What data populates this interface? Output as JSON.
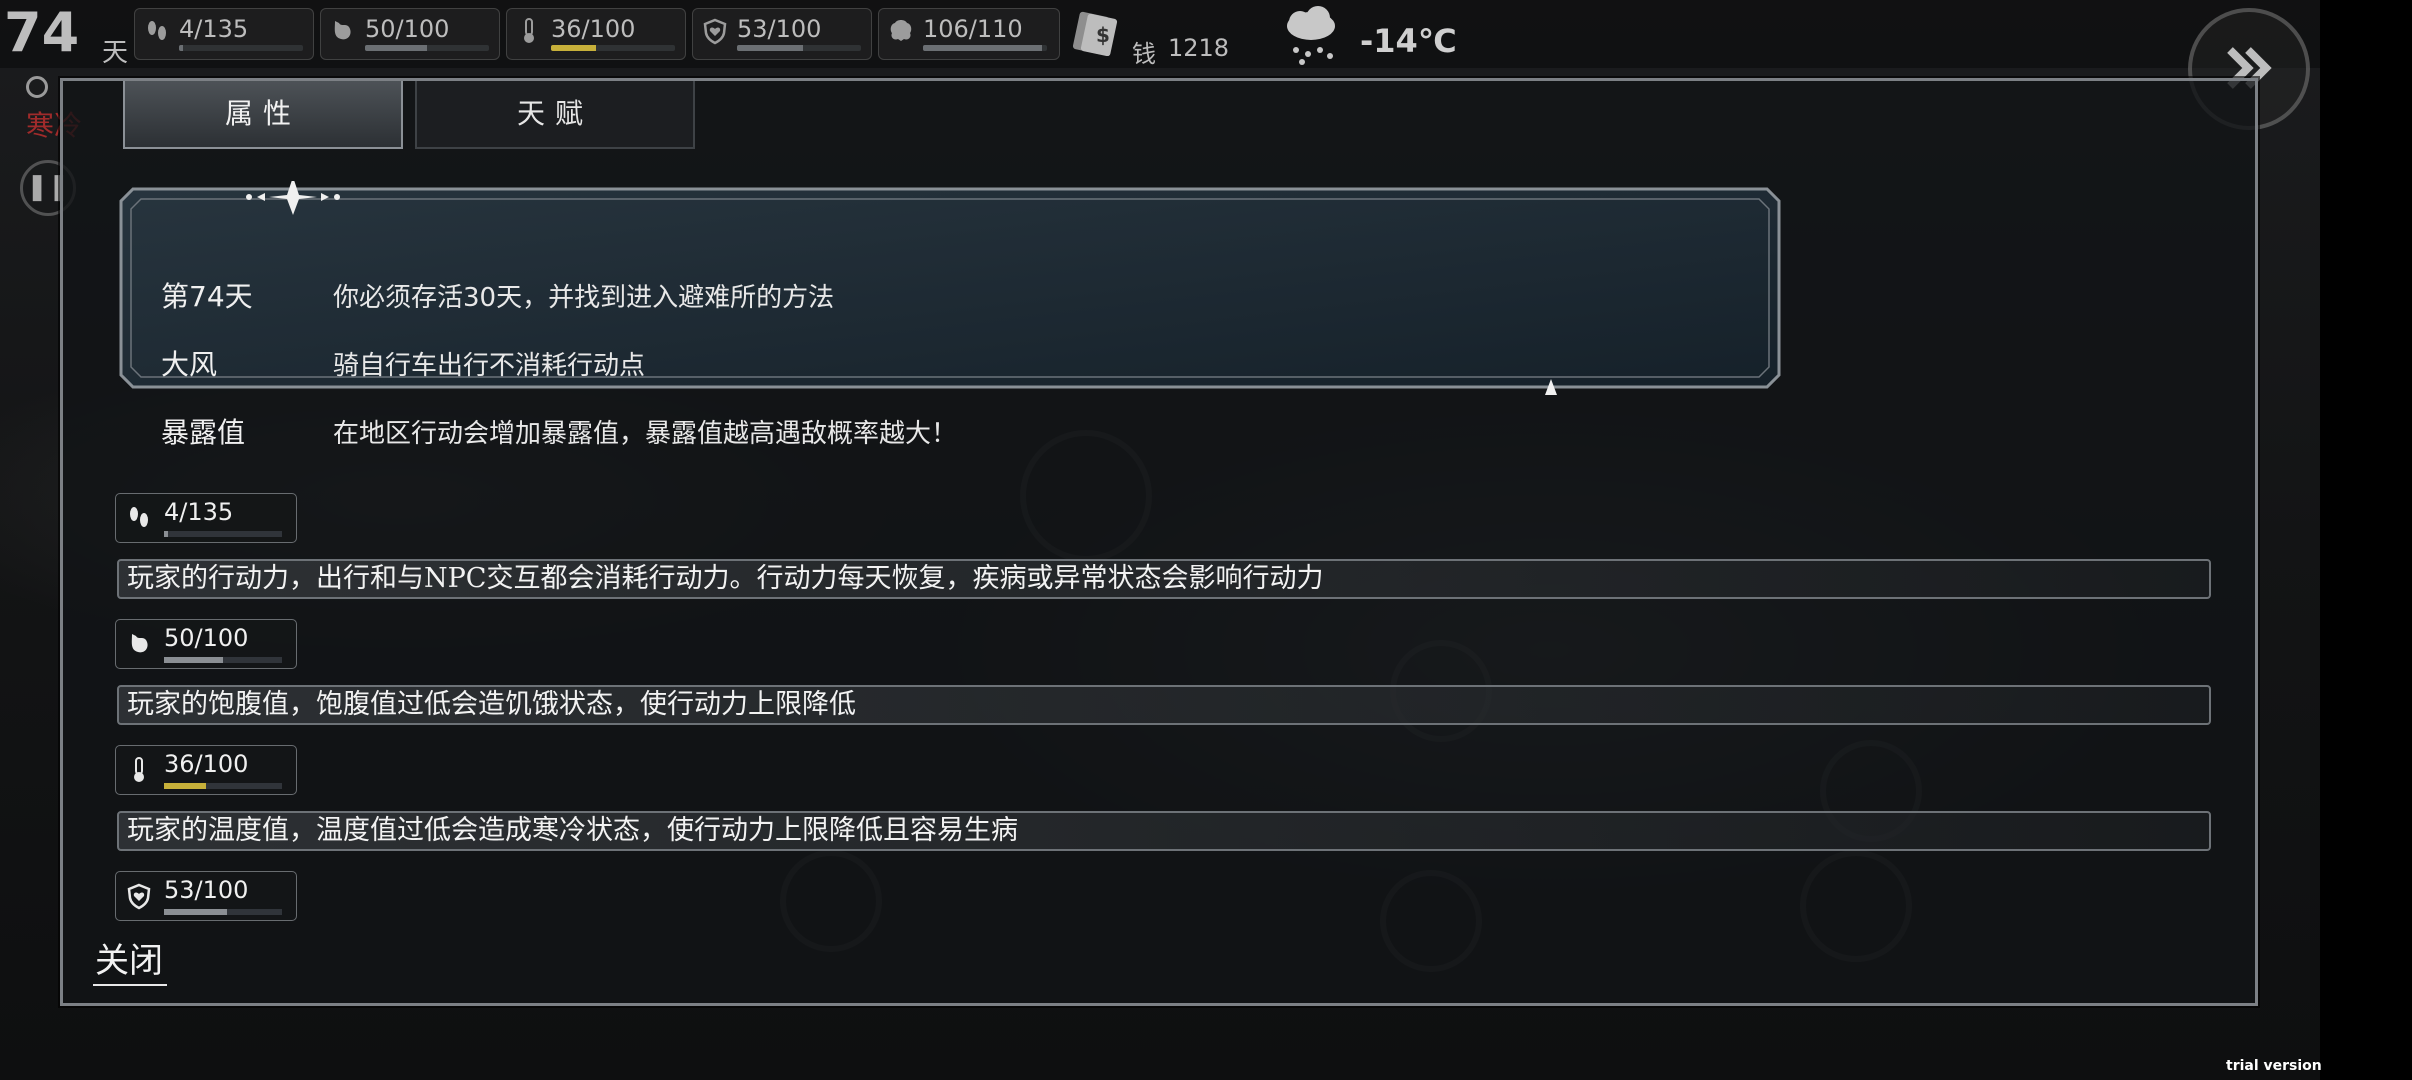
{
  "hud": {
    "day": "74",
    "day_unit": "天",
    "stats": [
      {
        "id": "action",
        "icon": "footprints-icon",
        "value": "4/135",
        "level": 0.03,
        "bar_color": "#6b6f73"
      },
      {
        "id": "hunger",
        "icon": "stomach-icon",
        "value": "50/100",
        "level": 0.5,
        "bar_color": "#6b6f73"
      },
      {
        "id": "temperature",
        "icon": "thermometer-icon",
        "value": "36/100",
        "level": 0.36,
        "bar_color": "#c7b03a"
      },
      {
        "id": "health",
        "icon": "heart-shield-icon",
        "value": "53/100",
        "level": 0.53,
        "bar_color": "#6b6f73"
      },
      {
        "id": "sanity",
        "icon": "brain-icon",
        "value": "106/110",
        "level": 0.96,
        "bar_color": "#6b6f73"
      }
    ],
    "money_label": "钱",
    "money_value": "1218",
    "temperature": "-14℃"
  },
  "side": {
    "cold_status": "寒冷"
  },
  "dialog": {
    "tabs": [
      {
        "label": "属性",
        "active": true
      },
      {
        "label": "天赋",
        "active": false
      }
    ],
    "info": [
      {
        "key": "第74天",
        "value": "你必须存活30天，并找到进入避难所的方法"
      },
      {
        "key": "大风",
        "value": "骑自行车出行不消耗行动点"
      },
      {
        "key": "暴露值",
        "value": "在地区行动会增加暴露值，暴露值越高遇敌概率越大！"
      }
    ],
    "attributes": [
      {
        "icon": "footprints-icon",
        "value": "4/135",
        "level": 0.03,
        "bar_color": "#8b8f94",
        "description": "玩家的行动力，出行和与NPC交互都会消耗行动力。行动力每天恢复，疾病或异常状态会影响行动力"
      },
      {
        "icon": "stomach-icon",
        "value": "50/100",
        "level": 0.5,
        "bar_color": "#8b8f94",
        "description": "玩家的饱腹值，饱腹值过低会造饥饿状态，使行动力上限降低"
      },
      {
        "icon": "thermometer-icon",
        "value": "36/100",
        "level": 0.36,
        "bar_color": "#c7b03a",
        "description": "玩家的温度值，温度值过低会造成寒冷状态，使行动力上限降低且容易生病"
      },
      {
        "icon": "heart-shield-icon",
        "value": "53/100",
        "level": 0.53,
        "bar_color": "#8b8f94",
        "description": ""
      }
    ],
    "close_label": "关闭"
  },
  "footer": {
    "trial": "trial version"
  }
}
